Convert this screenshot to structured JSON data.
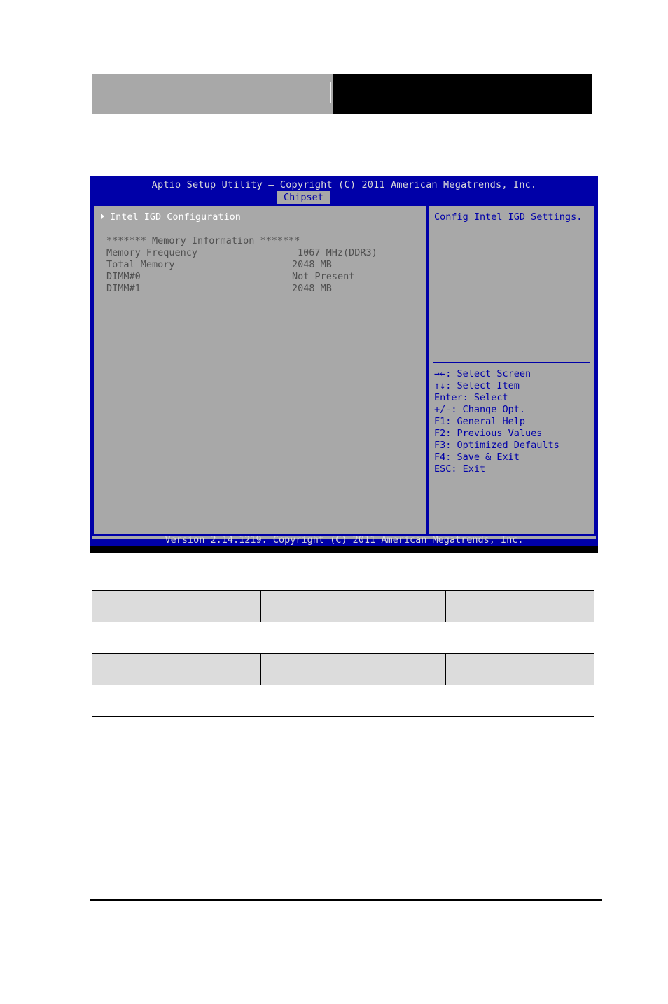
{
  "page": {
    "header": {
      "left_block_label": "",
      "right_block_label": ""
    },
    "footer_rule": ""
  },
  "bios": {
    "title": "Aptio Setup Utility – Copyright (C) 2011 American Megatrends, Inc.",
    "active_tab": "Chipset",
    "tabs": [
      "Chipset"
    ],
    "menu": {
      "items": [
        {
          "label": "Intel IGD Configuration",
          "marker": "submenu-arrow-icon"
        }
      ]
    },
    "memory_info": {
      "heading": "******* Memory Information *******",
      "rows": [
        {
          "label": "Memory Frequency",
          "value": "1067 MHz(DDR3)"
        },
        {
          "label": "Total Memory",
          "value": "2048 MB"
        },
        {
          "label": "DIMM#0",
          "value": "Not Present"
        },
        {
          "label": "DIMM#1",
          "value": "2048 MB"
        }
      ]
    },
    "help": {
      "text": "Config Intel IGD Settings.",
      "legend": [
        {
          "key": "→←",
          "action": ": Select Screen"
        },
        {
          "key": "↑↓",
          "action": ": Select Item"
        },
        {
          "key": "Enter",
          "action": ": Select"
        },
        {
          "key": "+/-",
          "action": ": Change Opt."
        },
        {
          "key": "F1",
          "action": ": General Help"
        },
        {
          "key": "F2",
          "action": ": Previous Values"
        },
        {
          "key": "F3",
          "action": ": Optimized Defaults"
        },
        {
          "key": "F4",
          "action": ": Save & Exit"
        },
        {
          "key": "ESC",
          "action": ": Exit"
        }
      ]
    },
    "version_footer": "Version 2.14.1219. Copyright (C) 2011 American Megatrends, Inc.",
    "colors": {
      "background_blue": "#0000a8",
      "panel_gray": "#a8a8a8",
      "title_text": "#d8d8d8",
      "menu_text": "#ffffff",
      "info_text": "#505050",
      "help_text": "#0000a8"
    }
  },
  "spec_table": {
    "rows": [
      {
        "type": "header",
        "cells": [
          "",
          "",
          ""
        ]
      },
      {
        "type": "body",
        "cells": [
          ""
        ]
      },
      {
        "type": "header",
        "cells": [
          "",
          "",
          ""
        ]
      },
      {
        "type": "body",
        "cells": [
          ""
        ]
      }
    ]
  }
}
